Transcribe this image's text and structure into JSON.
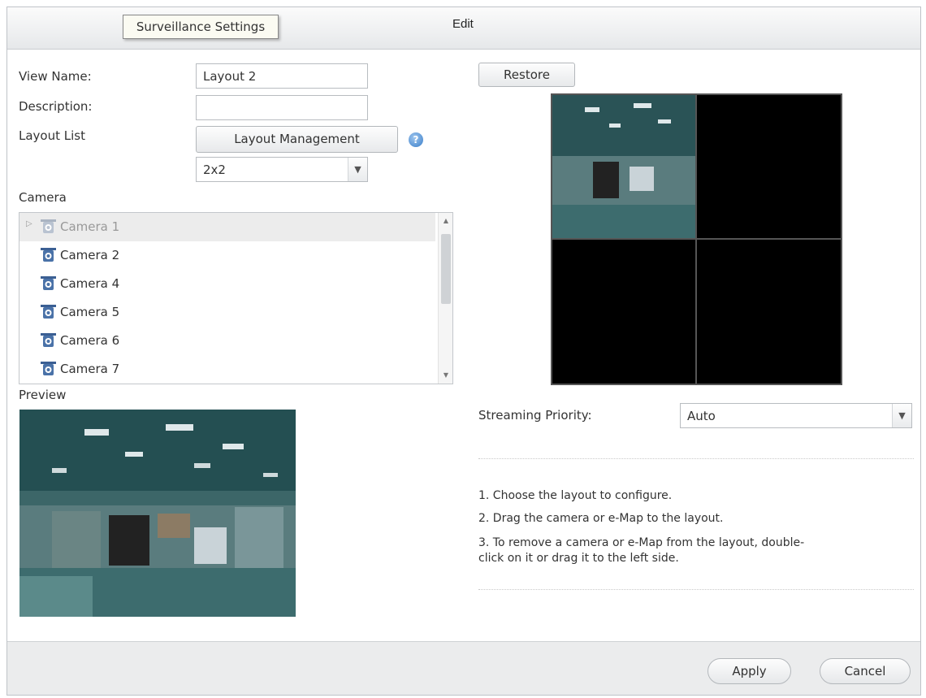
{
  "window": {
    "title": "Edit",
    "tooltip": "Surveillance Settings"
  },
  "form": {
    "view_name_label": "View Name:",
    "view_name_value": "Layout 2",
    "description_label": "Description:",
    "description_value": "",
    "layout_list_label": "Layout List",
    "layout_management_button": "Layout Management",
    "help_icon": "?",
    "layout_select_value": "2x2",
    "camera_label": "Camera",
    "preview_label": "Preview"
  },
  "cameras": [
    {
      "label": "Camera 1",
      "selected": true
    },
    {
      "label": "Camera 2",
      "selected": false
    },
    {
      "label": "Camera 4",
      "selected": false
    },
    {
      "label": "Camera 5",
      "selected": false
    },
    {
      "label": "Camera 6",
      "selected": false
    },
    {
      "label": "Camera 7",
      "selected": false
    }
  ],
  "right": {
    "restore_button": "Restore",
    "streaming_priority_label": "Streaming Priority:",
    "streaming_priority_value": "Auto",
    "instructions": [
      "1. Choose the layout to configure.",
      "2. Drag the camera or e-Map to the layout.",
      "3. To remove a camera or e-Map from the layout, double-",
      "click on it or drag it to the left side."
    ]
  },
  "footer": {
    "apply_button": "Apply",
    "cancel_button": "Cancel"
  },
  "colors": {
    "title_bar": "#e6e8ea",
    "footer": "#ebeced",
    "slot_background": "#000000",
    "camera_icon": "#4a72a8"
  },
  "icons": [
    "camera-icon",
    "chevron-down-icon",
    "help-icon",
    "expand-arrow-icon",
    "scroll-up-icon",
    "scroll-down-icon"
  ]
}
